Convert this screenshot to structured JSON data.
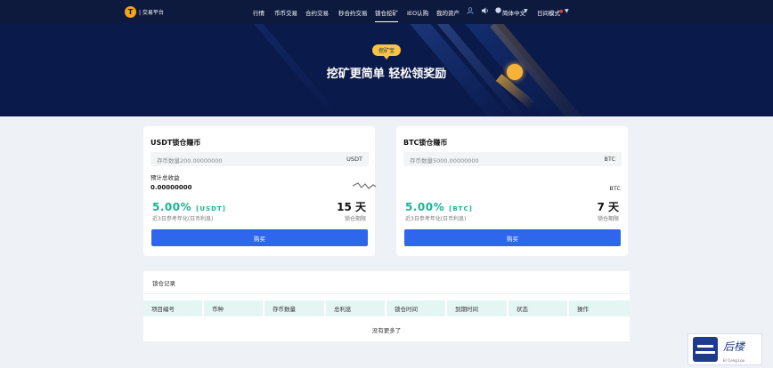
{
  "nav": {
    "logo_text": "| 交易平台",
    "items": [
      "行情",
      "币币交易",
      "合约交易",
      "秒合约交易",
      "锁仓挖矿",
      "IEO认购",
      "我的资产"
    ],
    "active_index": 4,
    "language": "简体中文",
    "theme": "日间模式"
  },
  "banner": {
    "badge": "挖矿宝",
    "title": "挖矿更简单 轻松领奖励"
  },
  "cards": [
    {
      "title": "USDT锁仓赚币",
      "input_placeholder": "存币数量200.00000000",
      "input_unit": "USDT",
      "estimated_label": "预计总收益",
      "estimated_value": "0.00000000",
      "side_unit": "",
      "rate": "5.00%",
      "rate_unit": "[USDT]",
      "rate_caption": "近3日参考年化(日币利息)",
      "days": "15 天",
      "days_caption": "锁仓期限",
      "button": "购买"
    },
    {
      "title": "BTC锁仓赚币",
      "input_placeholder": "存币数量5000.00000000",
      "input_unit": "BTC",
      "estimated_label": "",
      "estimated_value": "",
      "side_unit": "BTC",
      "rate": "5.00%",
      "rate_unit": "[BTC]",
      "rate_caption": "近3日参考年化(日币利息)",
      "days": "7 天",
      "days_caption": "锁仓期限",
      "button": "购买"
    }
  ],
  "records": {
    "title": "锁仓记录",
    "columns": [
      "项目编号",
      "币种",
      "存币数量",
      "总利息",
      "锁仓时间",
      "到期时间",
      "状态",
      "操作"
    ],
    "empty_text": "没有更多了"
  },
  "watermark": {
    "text": "后楼",
    "sub": "Er Ceng Lou"
  },
  "colors": {
    "nav_bg": "#0d1a3e",
    "banner_bg": "#0a1a4a",
    "accent_green": "#16b691",
    "button_blue": "#2f66ec",
    "badge_yellow": "#f7c542"
  }
}
